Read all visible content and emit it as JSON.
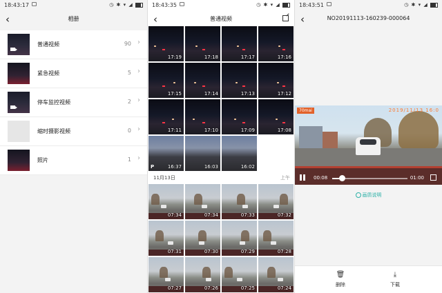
{
  "panel1": {
    "status_time": "18:43:17",
    "title": "相册",
    "albums": [
      {
        "label": "普通视频",
        "count": "90"
      },
      {
        "label": "紧急视频",
        "count": "5"
      },
      {
        "label": "停车监控视频",
        "count": "2"
      },
      {
        "label": "缩时摄影视频",
        "count": "0"
      },
      {
        "label": "照片",
        "count": "1"
      }
    ]
  },
  "panel2": {
    "status_time": "18:43:35",
    "title": "普通视频",
    "top_grid": [
      "17:19",
      "17:18",
      "17:17",
      "17:16",
      "17:15",
      "17:14",
      "17:13",
      "17:12",
      "17:11",
      "17:10",
      "17:09",
      "17:08",
      "16:37",
      "16:03",
      "16:02"
    ],
    "parking_badge": "P",
    "section_date": "11月13日",
    "section_ampm": "上午",
    "bottom_grid": [
      "07:34",
      "07:34",
      "07:33",
      "07:32",
      "07:31",
      "07:30",
      "07:29",
      "07:28",
      "07:27",
      "07:26",
      "07:25",
      "07:24"
    ]
  },
  "panel3": {
    "status_time": "18:43:51",
    "title": "NO20191113-160239-000064",
    "brand": "70mai",
    "current_time": "00:08",
    "total_time": "01:00",
    "progress": 0.133,
    "quality_link": "画质说明",
    "delete_label": "删除",
    "download_label": "下载"
  },
  "colors": {
    "accent": "#2cb1a7",
    "brand": "#e2622a"
  },
  "icons": [
    "back-arrow-icon",
    "edit-icon",
    "chevron-right-icon",
    "play-pause-icon",
    "fullscreen-icon",
    "info-icon",
    "trash-icon",
    "download-icon",
    "video-camera-icon"
  ]
}
